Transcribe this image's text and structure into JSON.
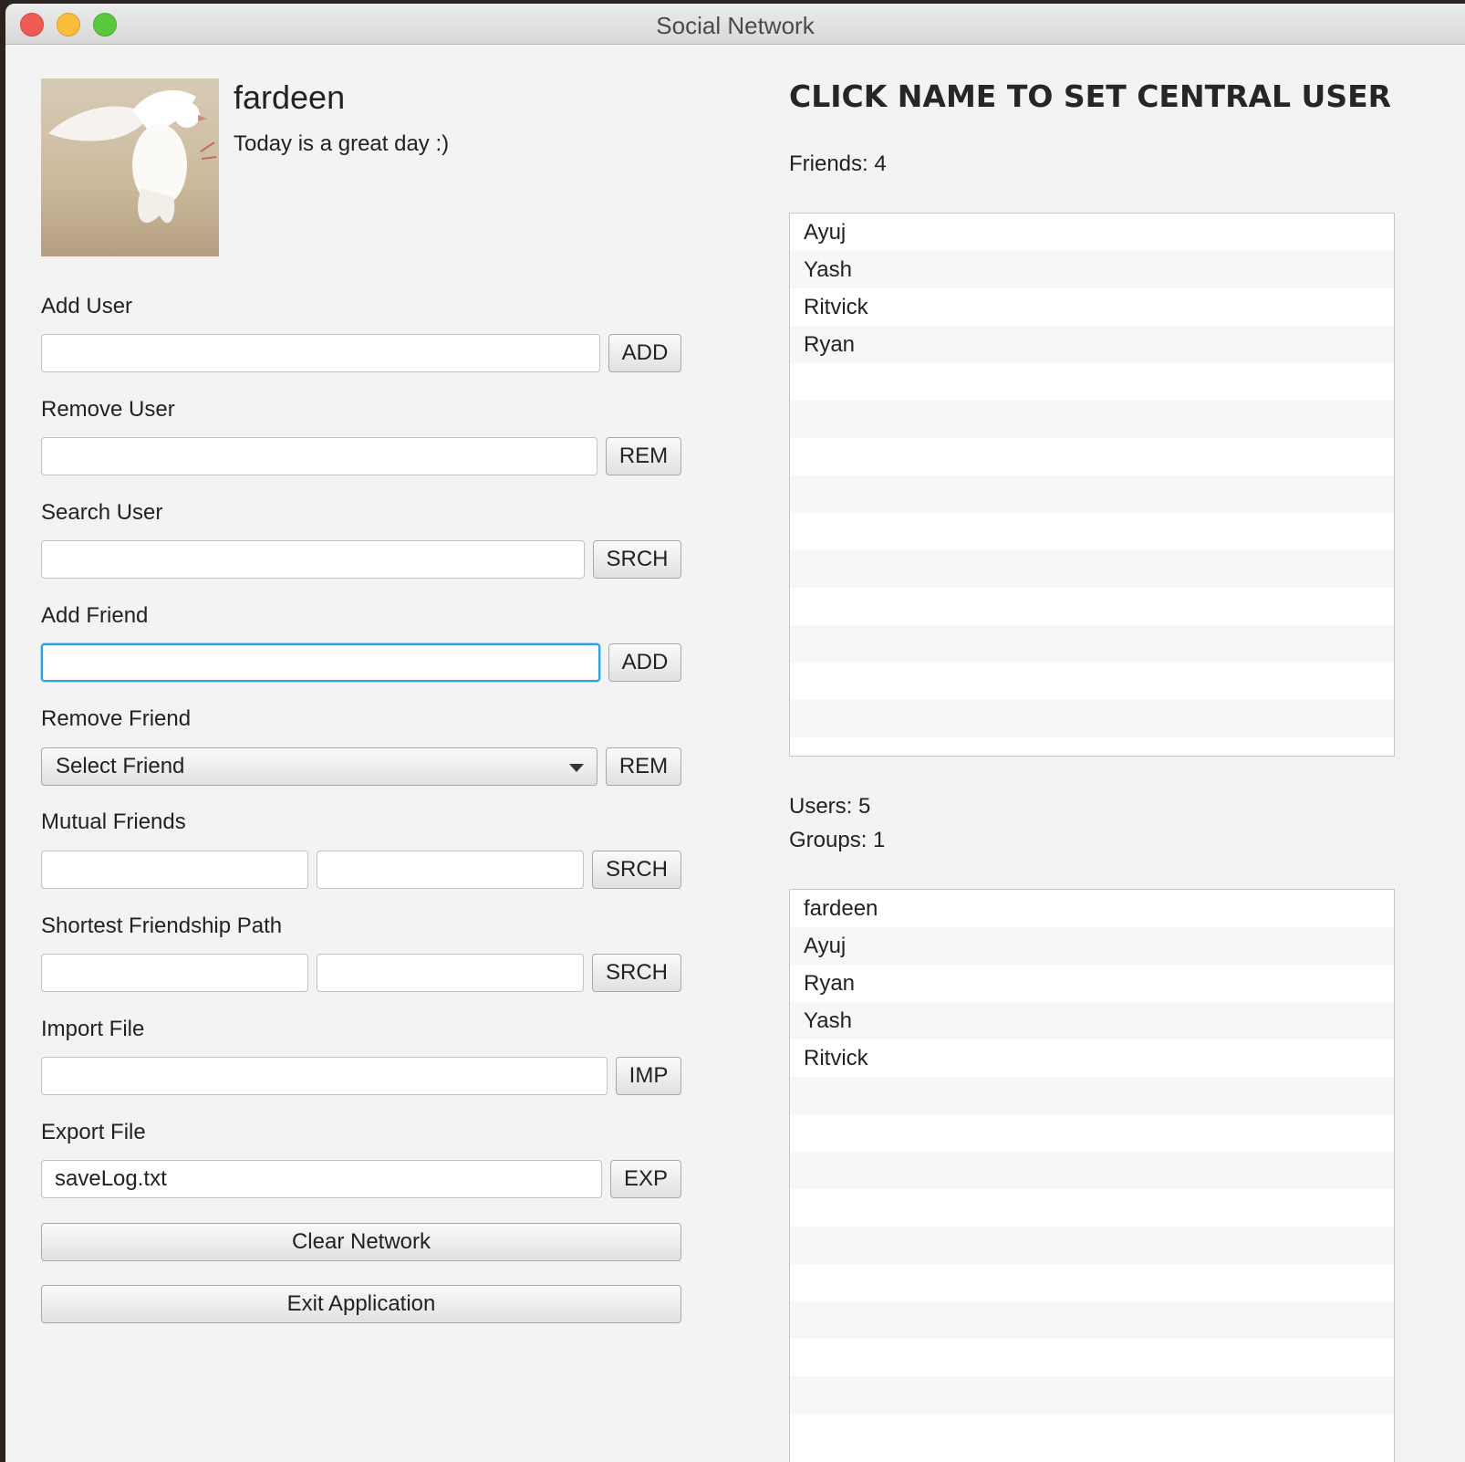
{
  "window": {
    "title": "Social Network"
  },
  "profile": {
    "name": "fardeen",
    "status": "Today is a great day :)"
  },
  "forms": {
    "add_user": {
      "label": "Add User",
      "value": "",
      "button": "ADD"
    },
    "remove_user": {
      "label": "Remove User",
      "value": "",
      "button": "REM"
    },
    "search_user": {
      "label": "Search User",
      "value": "",
      "button": "SRCH"
    },
    "add_friend": {
      "label": "Add Friend",
      "value": "",
      "button": "ADD"
    },
    "remove_friend": {
      "label": "Remove Friend",
      "selected": "Select Friend",
      "button": "REM"
    },
    "mutual_friends": {
      "label": "Mutual Friends",
      "value1": "",
      "value2": "",
      "button": "SRCH"
    },
    "shortest_path": {
      "label": "Shortest Friendship Path",
      "value1": "",
      "value2": "",
      "button": "SRCH"
    },
    "import_file": {
      "label": "Import File",
      "value": "",
      "button": "IMP"
    },
    "export_file": {
      "label": "Export File",
      "value": "saveLog.txt",
      "button": "EXP"
    }
  },
  "actions": {
    "clear": "Clear Network",
    "exit": "Exit Application"
  },
  "right": {
    "heading": "CLICK NAME TO SET CENTRAL USER",
    "friends_count": "Friends: 4",
    "friends": [
      "Ayuj",
      "Yash",
      "Ritvick",
      "Ryan"
    ],
    "users_count": "Users: 5",
    "groups_count": "Groups: 1",
    "users": [
      "fardeen",
      "Ayuj",
      "Ryan",
      "Yash",
      "Ritvick"
    ]
  },
  "icons": {
    "dropdown": "chevron-down-icon",
    "photo": "dove-photo"
  }
}
